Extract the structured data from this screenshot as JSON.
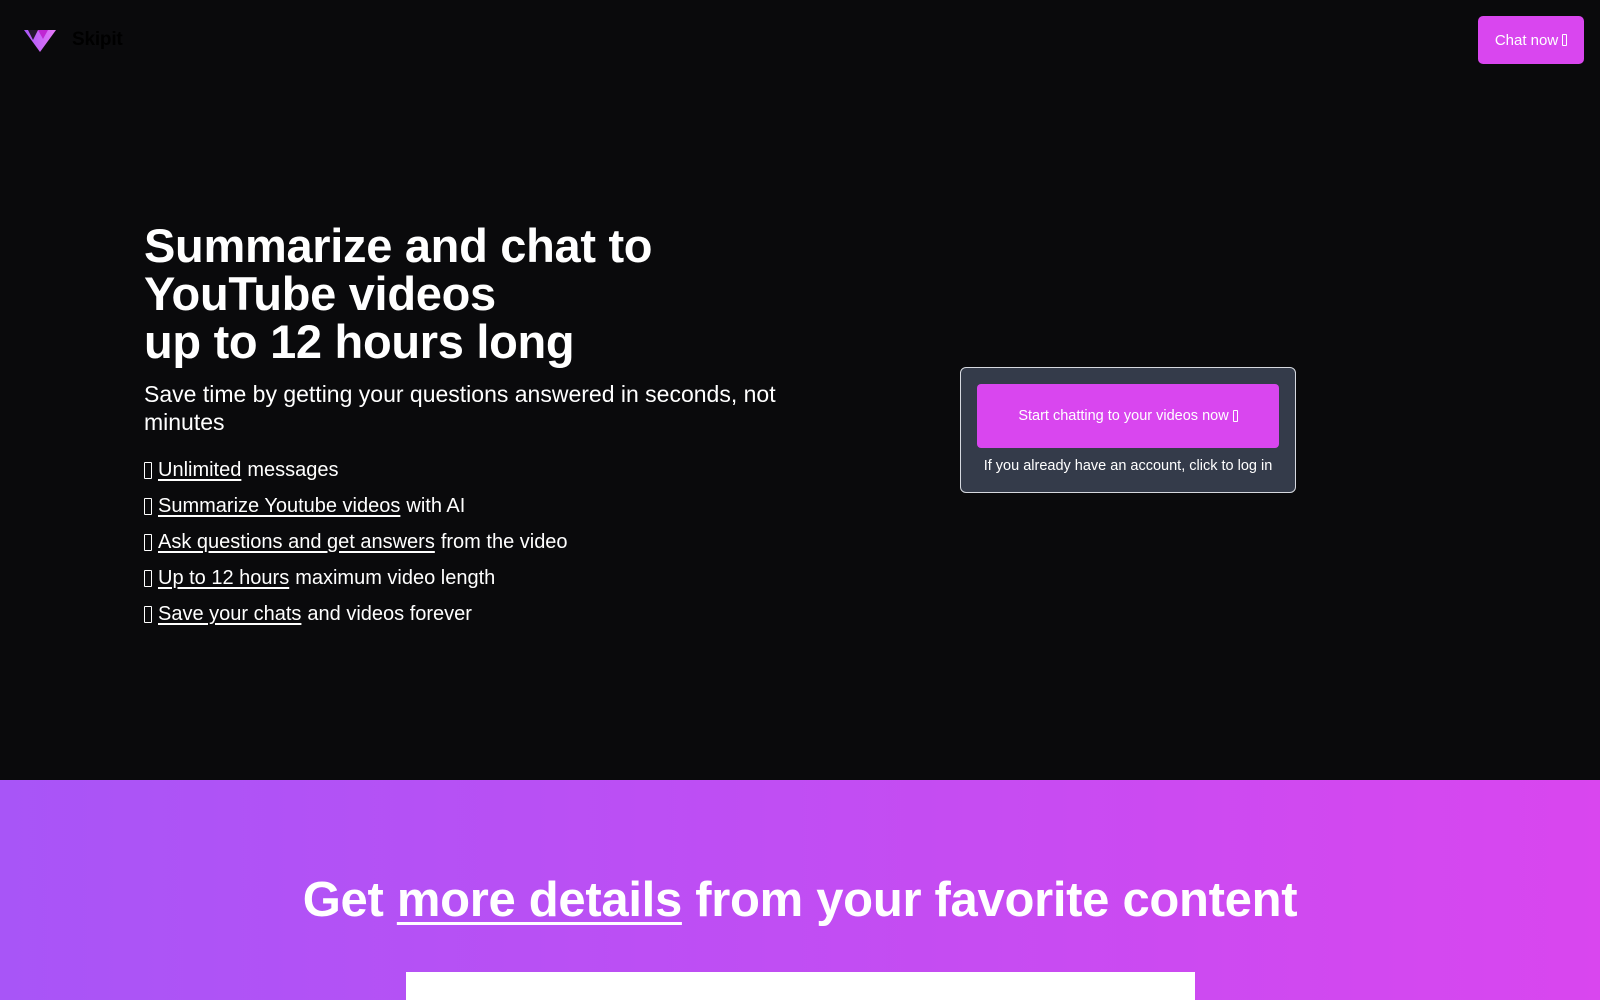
{
  "nav": {
    "brand_name": "Skipit",
    "cta_label": "Chat now"
  },
  "hero": {
    "title_lines": [
      "Summarize and chat to",
      "YouTube videos",
      "up to 12 hours long"
    ],
    "subtitle": "Save time by getting your questions answered in seconds, not minutes",
    "features": [
      {
        "link": "Unlimited",
        "rest": "messages"
      },
      {
        "link": "Summarize Youtube videos",
        "rest": "with AI"
      },
      {
        "link": "Ask questions and get answers",
        "rest": "from the video"
      },
      {
        "link": "Up to 12 hours",
        "rest": "maximum video length"
      },
      {
        "link": "Save your chats",
        "rest": "and videos forever"
      }
    ]
  },
  "cta": {
    "button_label": "Start chatting to your videos now",
    "login_text": "If you already have an account, click to log in"
  },
  "band": {
    "heading_pre": "Get",
    "heading_link": "more details",
    "heading_post": "from your favorite content"
  },
  "colors": {
    "background": "#0a0a0c",
    "accent": "#d946ef",
    "gradient_start": "#a855f7",
    "gradient_end": "#d946ef",
    "card_bg": "#343b4a"
  },
  "icons": {
    "logo": "triangle-logo-icon",
    "button_glyph": "arrow-glyph-icon",
    "feature_bullet": "check-glyph-icon"
  }
}
